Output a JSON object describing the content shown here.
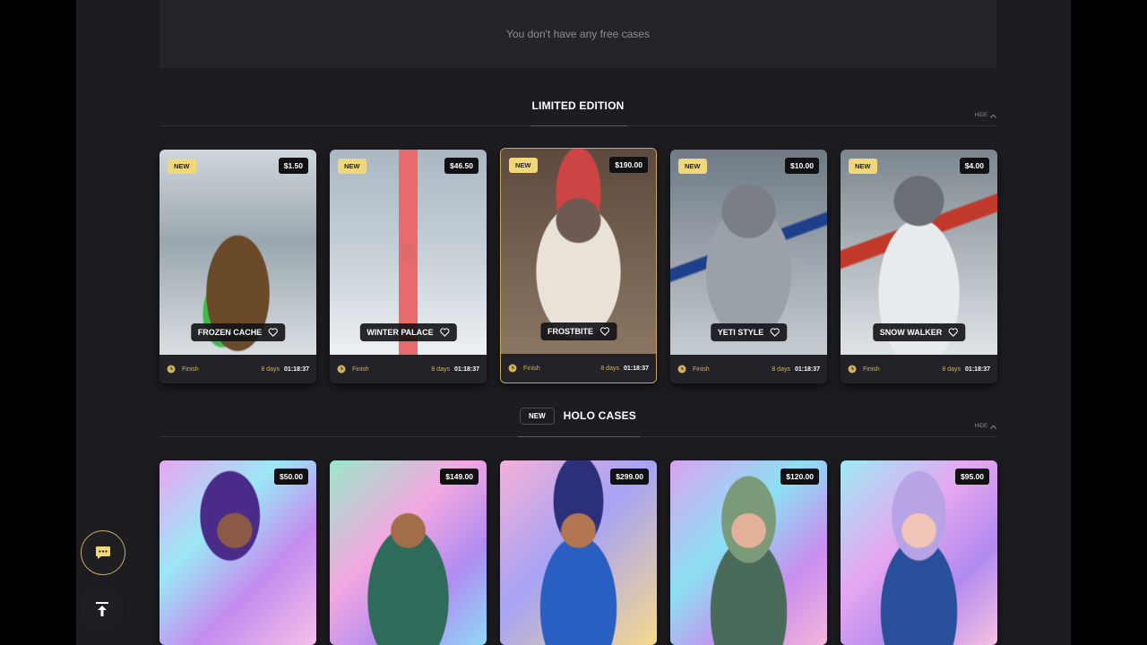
{
  "free_cases": {
    "message": "You don't have any free cases"
  },
  "limited": {
    "title": "LIMITED EDITION",
    "hide_label": "HIDE",
    "cards": [
      {
        "name": "FROZEN CACHE",
        "price": "$1.50",
        "badge": "NEW",
        "finish": "Finish",
        "days": "8 days",
        "time": "01:18:37"
      },
      {
        "name": "WINTER PALACE",
        "price": "$46.50",
        "badge": "NEW",
        "finish": "Finish",
        "days": "8 days",
        "time": "01:18:37"
      },
      {
        "name": "FROSTBITE",
        "price": "$190.00",
        "badge": "NEW",
        "finish": "Finish",
        "days": "8 days",
        "time": "01:18:37"
      },
      {
        "name": "YETI STYLE",
        "price": "$10.00",
        "badge": "NEW",
        "finish": "Finish",
        "days": "8 days",
        "time": "01:18:37"
      },
      {
        "name": "SNOW WALKER",
        "price": "$4.00",
        "badge": "NEW",
        "finish": "Finish",
        "days": "8 days",
        "time": "01:18:37"
      }
    ]
  },
  "holo": {
    "badge": "NEW",
    "title": "HOLO CASES",
    "hide_label": "HIDE",
    "cards": [
      {
        "price": "$50.00"
      },
      {
        "price": "$149.00"
      },
      {
        "price": "$299.00"
      },
      {
        "price": "$120.00"
      },
      {
        "price": "$95.00"
      }
    ]
  },
  "floating": {
    "chat_icon": "chat-icon",
    "scroll_top_icon": "arrow-up-icon"
  },
  "colors": {
    "accent": "#f1d77c",
    "gold": "#d4b15f",
    "page_bg": "#1c1c21"
  }
}
